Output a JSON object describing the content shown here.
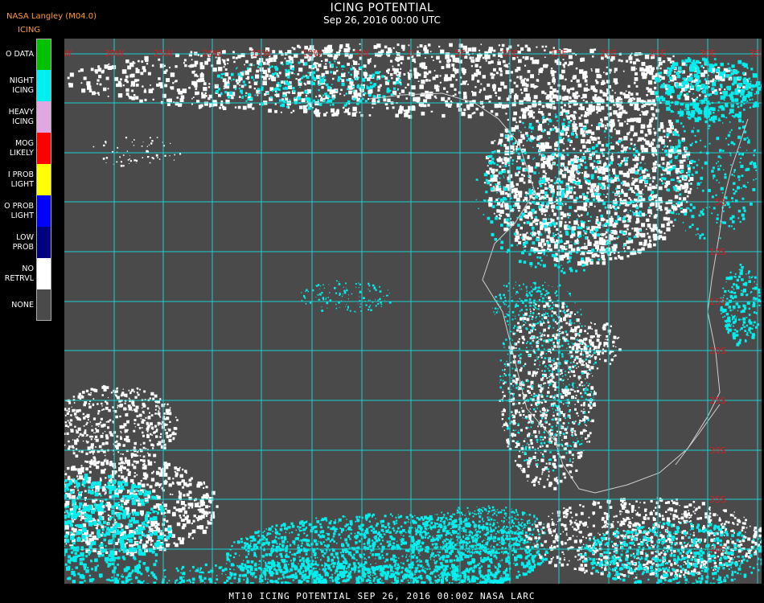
{
  "header": {
    "source": "NASA Langley (M04.0)",
    "legend_title": "ICING",
    "title": "ICING POTENTIAL",
    "subtitle": "Sep 26, 2016 00:00 UTC"
  },
  "legend": [
    {
      "label": "O DATA",
      "color": "#00c000",
      "icon": "no-data"
    },
    {
      "label": "NIGHT\nICING",
      "color": "#00f0f0",
      "icon": "night-icing"
    },
    {
      "label": "HEAVY\nICING",
      "color": "#e0a8e0",
      "icon": "heavy-icing"
    },
    {
      "label": "MOG\nLIKELY",
      "color": "#ff0000",
      "icon": "mog-likely"
    },
    {
      "label": "I PROB\nLIGHT",
      "color": "#ffff00",
      "icon": "hi-prob-light"
    },
    {
      "label": "O PROB\nLIGHT",
      "color": "#0000ff",
      "icon": "lo-prob-light"
    },
    {
      "label": "LOW\nPROB",
      "color": "#000080",
      "icon": "low-prob"
    },
    {
      "label": "NO\nRETRVL",
      "color": "#ffffff",
      "icon": "no-retrieval"
    },
    {
      "label": "NONE",
      "color": "#4a4a4a",
      "icon": "none"
    }
  ],
  "map": {
    "grid_color": "#19d3d3",
    "label_color": "#d02020",
    "lon_labels": [
      "35W",
      "30W",
      "25W",
      "20W",
      "15W",
      "10W",
      "5W",
      "0",
      "5E",
      "10E",
      "15E",
      "20E",
      "25E",
      "30E",
      "35E"
    ],
    "lat_labels": [
      "5S",
      "10S",
      "15S",
      "20S",
      "25S",
      "30S",
      "35S",
      "40S"
    ]
  },
  "footer": {
    "text": "MT10  ICING POTENTIAL   SEP 26, 2016 00:00Z   NASA LARC"
  }
}
